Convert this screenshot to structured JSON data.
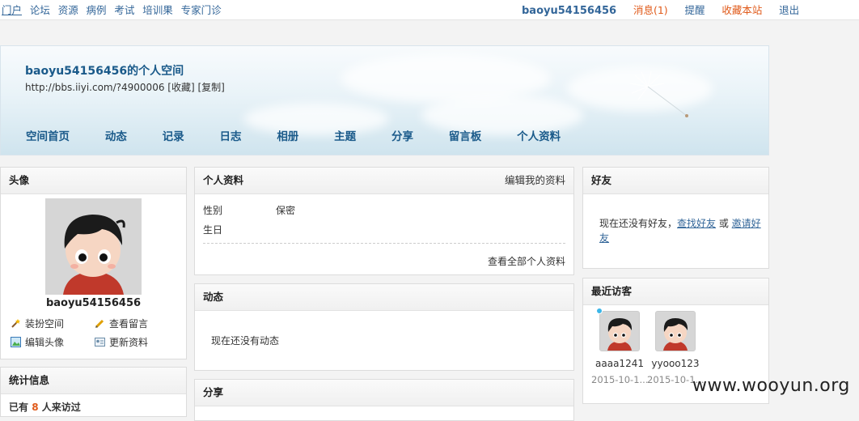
{
  "topnav": [
    "门户",
    "论坛",
    "资源",
    "病例",
    "考试",
    "培训果",
    "专家门诊"
  ],
  "topright": {
    "username": "baoyu54156456",
    "messages": "消息(1)",
    "remind": "提醒",
    "bookmark": "收藏本站",
    "logout": "退出"
  },
  "banner": {
    "title": "baoyu54156456的个人空间",
    "url": "http://bbs.iiyi.com/?4900006 [收藏] [复制]",
    "nav": [
      "空间首页",
      "动态",
      "记录",
      "日志",
      "相册",
      "主题",
      "分享",
      "留言板",
      "个人资料"
    ]
  },
  "avatar_panel": {
    "title": "头像",
    "username": "baoyu54156456",
    "actions": [
      "装扮空间",
      "查看留言",
      "编辑头像",
      "更新资料"
    ]
  },
  "stats_panel": {
    "title": "统计信息",
    "text_prefix": "已有",
    "count": "8",
    "text_suffix": "人来访过"
  },
  "profile_panel": {
    "title": "个人资料",
    "edit_link": "编辑我的资料",
    "fields": [
      {
        "label": "性别",
        "value": "保密"
      },
      {
        "label": "生日",
        "value": ""
      }
    ],
    "view_all": "查看全部个人资料"
  },
  "feed_panel": {
    "title": "动态",
    "empty": "现在还没有动态"
  },
  "share_panel": {
    "title": "分享"
  },
  "friends_panel": {
    "title": "好友",
    "text1": "现在还没有好友，",
    "find": "查找好友",
    "or": " 或 ",
    "invite": "邀请好友"
  },
  "visitors_panel": {
    "title": "最近访客",
    "visitors": [
      {
        "name": "aaaa1241",
        "date": "2015-10-1..."
      },
      {
        "name": "yyooo123",
        "date": "2015-10-1..."
      }
    ]
  },
  "watermark": "www.wooyun.org",
  "colors": {
    "link": "#336699",
    "accent": "#e05a1a",
    "count": "#e05a1a"
  }
}
